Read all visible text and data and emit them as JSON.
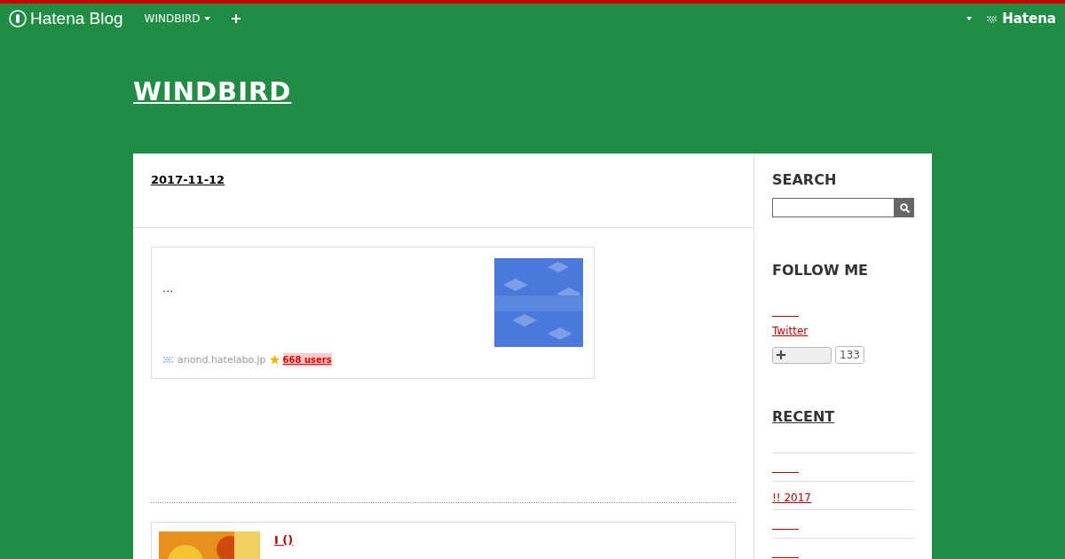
{
  "globalheader": {
    "brand": "Hatena Blog",
    "blog_menu": "WINDBIRD",
    "service": "Hatena"
  },
  "blog_title": "WINDBIRD",
  "entry": {
    "date": "2017-11-12",
    "embed": {
      "excerpt": "...",
      "site": "anond.hatelabo.jp",
      "bookmarks": "668 users"
    },
    "related": {
      "title": "I ()"
    }
  },
  "sidebar": {
    "search": {
      "heading": "SEARCH"
    },
    "follow": {
      "heading": "FOLLOW ME",
      "link": "Twitter",
      "count": "133"
    },
    "recent": {
      "heading": "RECENT",
      "items": [
        {
          "kind": "blank"
        },
        {
          "kind": "text",
          "title": "!! 2017"
        },
        {
          "kind": "blank"
        },
        {
          "kind": "blank"
        }
      ]
    }
  }
}
